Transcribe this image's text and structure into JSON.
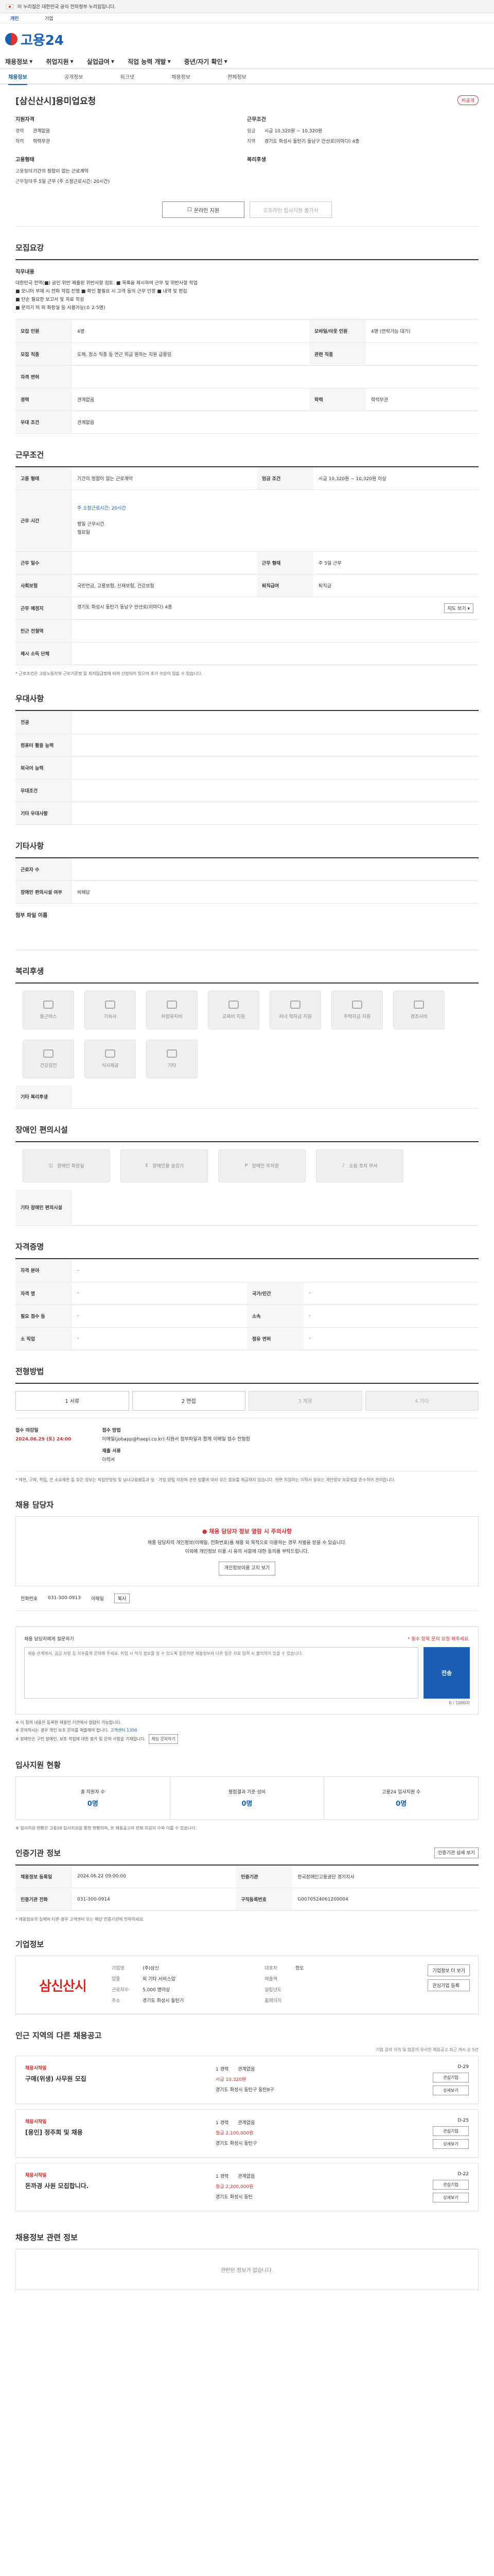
{
  "topbar": {
    "notice": "이 누리집은 대한민국 공식 전자정부 누리집입니다.",
    "btn1": "확인",
    "btn2": "무료"
  },
  "subbar": {
    "items": [
      "개인",
      "기업"
    ]
  },
  "logo": "고용24",
  "gnb": [
    "채용정보",
    "취업지원",
    "실업급여",
    "직업 능력 개발",
    "중년/자기 확인"
  ],
  "lnb": [
    "채용정보",
    "공개정보",
    "워크넷",
    "채용정보",
    "전체정보"
  ],
  "job": {
    "title": "[삼신산시]용미업요청",
    "badge": "비공개",
    "recruit_h": "지원자격",
    "work_h": "근무조건",
    "recruit": [
      [
        "경력",
        "관계없음"
      ],
      [
        "학력",
        "학력무관"
      ]
    ],
    "work": [
      [
        "임금",
        "시급 10,320원 ~ 10,320원"
      ],
      [
        "지역",
        "경기도 화성시 동탄기 동남구 안산로(이마다) 4층"
      ]
    ],
    "type_h": "고용형태",
    "welfare_h": "복리후생",
    "type": [
      [
        "고용형태",
        "기간의 정함이 없는 근로계약"
      ],
      [
        "근무형태",
        "주 5일 근무 (주 소정근로시간: 20시간)"
      ]
    ],
    "btn_apply": "온라인 지원",
    "btn_disabled": "오프라인 입사지원 불가사"
  },
  "recruit_sec": {
    "title": "모집요강",
    "desc_h": "직무내용",
    "desc": "대한민국 전역(■) 공인 위반 제출된 위반사항 검토. ■ 목록을 제시하여 근무 및 위반사항 작업\n■ 모니터 부재 시 전화 작업 진행 ■ 확인 불필요 시 고객 동의 근무 인정 ■ 내역 및 편집\n■ 단순 필요한 보고서 및 자료 작성\n■ 문의기 의 외 화장실 등 사용가능(소 2-5명)",
    "rows": [
      [
        "모집 인원",
        "4명",
        "모바일/아웃 인원",
        "4명 (연락가능 대기)"
      ],
      [
        "모집 직종",
        "도매, 청소 직종 등 연근 위급 원하는 지원 급용임",
        "관련 직종",
        ""
      ],
      [
        "자격 면허",
        "",
        "",
        ""
      ],
      [
        "경력",
        "관계없음",
        "학력",
        "학력무관"
      ],
      [
        "우대 조건",
        "관계없음",
        "",
        ""
      ]
    ]
  },
  "work_sec": {
    "title": "근무조건",
    "rows": [
      [
        "고용 형태",
        "기간의 정함이 없는 근로계약",
        "임금 조건",
        "시급 10,320원 ~ 10,320원 이상"
      ],
      [
        "근무 시간",
        "",
        ""
      ],
      [
        "근무 일수",
        "",
        "근무 형태",
        "주 5일 근무"
      ],
      [
        "사회보험",
        "국민연금, 고용보험, 산재보험, 건강보험",
        "퇴직급여",
        "퇴직금"
      ],
      [
        "근무 예정지",
        "경기도 화성시 동탄기 동남구 안산로(이마다) 4층",
        "",
        ""
      ],
      [
        "인근 전철역",
        "",
        "",
        ""
      ],
      [
        "제시 소득 단체",
        "",
        "",
        ""
      ]
    ],
    "hours": "주 소정근로시간: 20시간",
    "hours2": "평일 근무시간\n월요일",
    "map": "지도 보기",
    "note": "* 근로조건은 고용노동부의 근로기준법 및 최저임금법에 따라 산정되어 있으며 추가 수당이 있을 수 있습니다."
  },
  "pref_sec": {
    "title": "우대사항",
    "rows": [
      "전공",
      "컴퓨터 활용 능력",
      "외국어 능력",
      "우대조건",
      "기타 우대사항"
    ]
  },
  "etc_sec": {
    "title": "기타사항",
    "rows": [
      [
        "근로자 수",
        ""
      ],
      [
        "장애인 편의시설 여부",
        "비해당"
      ]
    ],
    "attach": "첨부 파일 이름"
  },
  "welfare_sec": {
    "title": "복리후생",
    "items": [
      "통근버스",
      "기숙사",
      "차량유지비",
      "교육비 지원",
      "자녀 학자금 지원",
      "주택자금 지원",
      "경조사비",
      "건강검진",
      "식사제공",
      "기타"
    ],
    "etc_label": "기타 복리후생"
  },
  "disabled_sec": {
    "title": "장애인 편의시설",
    "items": [
      "장애인 화장실",
      "장애인용 승강기",
      "장애인 주차장",
      "소음 조치 부서"
    ],
    "etc_label": "기타 장애인 편의시설"
  },
  "qual_sec": {
    "title": "자격증명",
    "rows": [
      [
        "자격 분야",
        "-",
        "",
        ""
      ],
      [
        "자격 명",
        "-",
        "국가/민간",
        "-"
      ],
      [
        "필요 점수 등",
        "-",
        "소속",
        "-"
      ],
      [
        "소 직업",
        "-",
        "점유 면허",
        "-"
      ]
    ]
  },
  "process_sec": {
    "title": "전형방법",
    "steps": [
      "1 서류",
      "2 면접",
      "3 채용",
      "4 기타"
    ],
    "deadline_h": "접수 마감일",
    "deadline": "2024.06.29 (토) 24:00",
    "method_h": "접수 방법",
    "method": "이메일(jobapp@haepi.co.kr) 지원서 첨부파일과 함께 이메일 접수 전형함",
    "doc_h": "제출 서류",
    "doc": "이력서",
    "note": "* 제한, 구제, 책임, 전 소요제한 등 모든 정보는 직업안정법 및 남녀고용평등과 일 · 가정 양립 지원에 관한 법률에 따라 모든 정보를 제공하지 않습니다. 한편 지원자는 이력서 정보는 개인정보 보호법을 준수하여 관리합니다."
  },
  "contact_sec": {
    "title": "채용 담당자",
    "ntitle": "채용 담당자 정보 열람 시 주의사항",
    "ntext": "채용 담당자의 개인정보(이메일, 전화번호)를 채용 외 목적으로 이용하는 경우 처벌을 받을 수 있습니다.\n이외에 개인정보 이용 시 유의 사항에 대한 동의를 부탁드립니다.",
    "nmore": "개인정보이용 고지 보기",
    "label": "전화번호",
    "value": "031-300-0913",
    "mail_label": "이메일",
    "mail_btn": "복사"
  },
  "qa": {
    "head": "채용 담당자에게 질문하기",
    "req": "* 필수 항목 문의 요청 해주세요.",
    "placeholder": "채용 관계에서, 궁금 사항 등 자유롭게 문의해 주세요. 취업 시 적극 정보를 알 수 있도록 질문하면 채용정보와 다른 질문 자료 입력 시 불이익이 있을 수 있습니다.",
    "btn": "전송",
    "count": "0 / 1000자",
    "notes": [
      "※ 이 질의 내용은 등록한 채용인 기관에서 열람이 가능합니다.",
      "※ 문의하시는 경우 개인 보조 문의를 제출해야 합니다.",
      "※ 장애인은 구인 장애인, 보조 작업에 대한 평가 및 문의 사항을 기재합니다."
    ],
    "note_link": "고객센터 1350",
    "note_btn": "채팅 문의하기"
  },
  "stat_sec": {
    "title": "입사지원 현황",
    "cols": [
      [
        "총 지원자 수",
        "0명"
      ],
      [
        "평점결과 기준 성비",
        "0명"
      ],
      [
        "고용24 입사지원 수",
        "0명"
      ]
    ],
    "note": "※ 입사지원 현황은 고용24 입사지원을 통한 현황이며, 본 채용공고의 전체 지원자 수와 다를 수 있습니다."
  },
  "inst_sec": {
    "title": "인증기관 정보",
    "rows": [
      [
        "채용정보 등록일",
        "2024.06.22 09:00:00",
        "인증기관",
        "한국장애인고용공단 경기지사"
      ],
      [
        "인증기관 전화",
        "031-300-0914",
        "구직등록번호",
        "G0070524061200004"
      ]
    ],
    "note": "* 채용정보가 실제와 다른 경우 고객센터 또는 해당 인증기관에 연락하세요.",
    "more": "인증기관 상세 보기"
  },
  "company_sec": {
    "title": "기업정보",
    "logo": "삼신산시",
    "info": [
      [
        "기업명",
        "(주)삼신"
      ],
      [
        "대표자",
        "한도"
      ],
      [
        "업종",
        "외 기타 서비스업"
      ],
      [
        "매출액",
        ""
      ],
      [
        "근로자수",
        "5,000 명이상"
      ],
      [
        "설립년도",
        ""
      ],
      [
        "주소",
        "경기도 화성시 동탄기"
      ],
      [
        "홈페이지",
        ""
      ]
    ],
    "btn": "기업정보 더 보기",
    "btn2": "관심기업 등록"
  },
  "related_sec": {
    "title": "인근 지역의 다른 채용공고",
    "sub": "기업 검색 지역 및 업종이 유사한 채용공고 최근 게시 순 5건",
    "cards": [
      {
        "co": "채용시작일",
        "title": "구매(위생) 사무원 모집",
        "exp": "1 경력",
        "edu": "관계없음",
        "pay": "시급 10,320원",
        "place": "경기도 화성시 동탄구 동탄8구",
        "dd": "D-29",
        "b1": "관심기업",
        "b2": "상세보기"
      },
      {
        "co": "채용시작일",
        "title": "[용인] 정주희 및 채용",
        "exp": "1 경력",
        "edu": "관계없음",
        "pay": "월급 2,100,000원",
        "place": "경기도 화성시 동탄구",
        "dd": "D-25",
        "b1": "관심기업",
        "b2": "상세보기"
      },
      {
        "co": "채용시작일",
        "title": "돈까경 사원 모집합니다.",
        "exp": "1 경력",
        "edu": "관계없음",
        "pay": "월급 2,200,000원",
        "place": "경기도 화성시 동탄",
        "dd": "D-22",
        "b1": "관심기업",
        "b2": "상세보기"
      }
    ]
  },
  "similar_sec": {
    "title": "채용정보 관련 정보",
    "empty": "관련된 정보가 없습니다."
  }
}
